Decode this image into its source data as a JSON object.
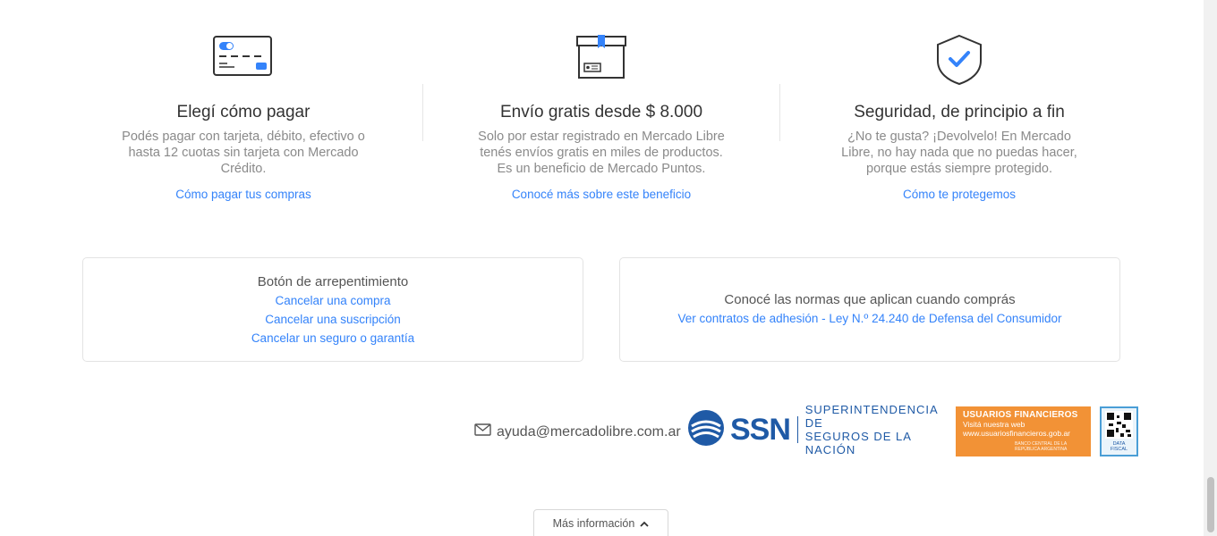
{
  "features": [
    {
      "icon": "credit-card-icon",
      "title": "Elegí cómo pagar",
      "text": "Podés pagar con tarjeta, débito, efectivo o hasta 12 cuotas sin tarjeta con Mercado Crédito.",
      "link": "Cómo pagar tus compras"
    },
    {
      "icon": "shipping-box-icon",
      "title": "Envío gratis desde $ 8.000",
      "text": "Solo por estar registrado en Mercado Libre tenés envíos gratis en miles de productos. Es un beneficio de Mercado Puntos.",
      "link": "Conocé más sobre este beneficio"
    },
    {
      "icon": "shield-check-icon",
      "title": "Seguridad, de principio a fin",
      "text": "¿No te gusta? ¡Devolvelo! En Mercado Libre, no hay nada que no puedas hacer, porque estás siempre protegido.",
      "link": "Cómo te protegemos"
    }
  ],
  "repentance": {
    "title": "Botón de arrepentimiento",
    "links": [
      "Cancelar una compra",
      "Cancelar una suscripción",
      "Cancelar un seguro o garantía"
    ]
  },
  "norms": {
    "title": "Conocé las normas que aplican cuando comprás",
    "link": "Ver contratos de adhesión - Ley N.º 24.240 de Defensa del Consumidor"
  },
  "footer": {
    "email": "ayuda@mercadolibre.com.ar",
    "ssn": {
      "acronym": "SSN",
      "name_line1": "SUPERINTENDENCIA DE",
      "name_line2": "SEGUROS DE LA NACIÓN"
    },
    "usuarios_financieros": {
      "title": "USUARIOS FINANCIEROS",
      "line1": "Visitá nuestra web",
      "line2": "www.usuariosfinancieros.gob.ar",
      "bank": "BANCO CENTRAL DE LA REPÚBLICA ARGENTINA"
    },
    "data_fiscal": "DATA FISCAL"
  },
  "more_info": "Más información",
  "colors": {
    "link": "#3483fa",
    "ssn_blue": "#1f5aa6",
    "uf_orange": "#f29236"
  }
}
